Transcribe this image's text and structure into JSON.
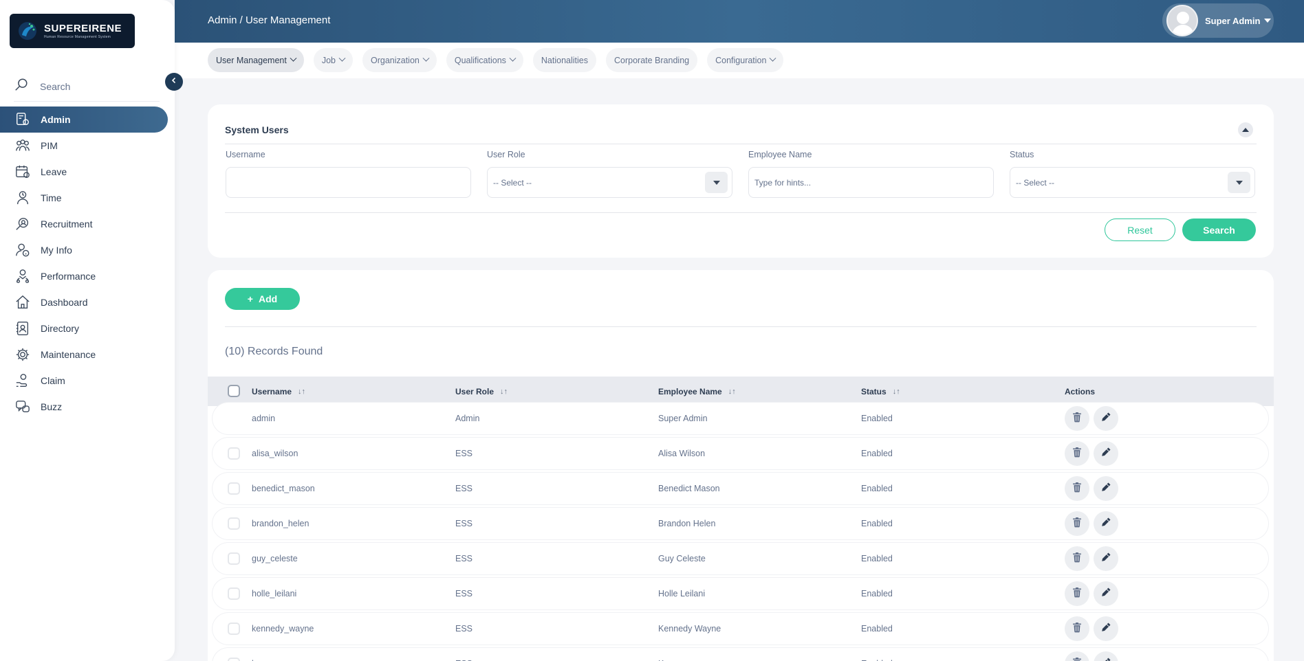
{
  "brand": {
    "name": "SUPEREIRENE",
    "tagline": "Human Resource Management System"
  },
  "sidebar": {
    "search_label": "Search",
    "items": [
      {
        "label": "Admin",
        "icon": "admin-icon",
        "active": true
      },
      {
        "label": "PIM",
        "icon": "pim-icon"
      },
      {
        "label": "Leave",
        "icon": "leave-icon"
      },
      {
        "label": "Time",
        "icon": "time-icon"
      },
      {
        "label": "Recruitment",
        "icon": "recruitment-icon"
      },
      {
        "label": "My Info",
        "icon": "my-info-icon"
      },
      {
        "label": "Performance",
        "icon": "performance-icon"
      },
      {
        "label": "Dashboard",
        "icon": "dashboard-icon"
      },
      {
        "label": "Directory",
        "icon": "directory-icon"
      },
      {
        "label": "Maintenance",
        "icon": "maintenance-icon"
      },
      {
        "label": "Claim",
        "icon": "claim-icon"
      },
      {
        "label": "Buzz",
        "icon": "buzz-icon"
      }
    ]
  },
  "header": {
    "breadcrumb": "Admin / User Management",
    "user_name": "Super Admin"
  },
  "tabs": [
    {
      "label": "User Management",
      "dropdown": true,
      "active": true
    },
    {
      "label": "Job",
      "dropdown": true
    },
    {
      "label": "Organization",
      "dropdown": true
    },
    {
      "label": "Qualifications",
      "dropdown": true
    },
    {
      "label": "Nationalities",
      "dropdown": false
    },
    {
      "label": "Corporate Branding",
      "dropdown": false
    },
    {
      "label": "Configuration",
      "dropdown": true
    }
  ],
  "filter": {
    "title": "System Users",
    "username": {
      "label": "Username",
      "value": ""
    },
    "user_role": {
      "label": "User Role",
      "value": "-- Select --"
    },
    "employee_name": {
      "label": "Employee Name",
      "placeholder": "Type for hints..."
    },
    "status": {
      "label": "Status",
      "value": "-- Select --"
    },
    "reset_label": "Reset",
    "search_label": "Search"
  },
  "table": {
    "add_label": "Add",
    "records_text": "(10) Records Found",
    "columns": [
      "Username",
      "User Role",
      "Employee Name",
      "Status",
      "Actions"
    ],
    "rows": [
      {
        "username": "admin",
        "role": "Admin",
        "employee": "Super Admin",
        "status": "Enabled",
        "checkbox": false
      },
      {
        "username": "alisa_wilson",
        "role": "ESS",
        "employee": "Alisa Wilson",
        "status": "Enabled",
        "checkbox": true
      },
      {
        "username": "benedict_mason",
        "role": "ESS",
        "employee": "Benedict Mason",
        "status": "Enabled",
        "checkbox": true
      },
      {
        "username": "brandon_helen",
        "role": "ESS",
        "employee": "Brandon Helen",
        "status": "Enabled",
        "checkbox": true
      },
      {
        "username": "guy_celeste",
        "role": "ESS",
        "employee": "Guy Celeste",
        "status": "Enabled",
        "checkbox": true
      },
      {
        "username": "holle_leilani",
        "role": "ESS",
        "employee": "Holle Leilani",
        "status": "Enabled",
        "checkbox": true
      },
      {
        "username": "kennedy_wayne",
        "role": "ESS",
        "employee": "Kennedy Wayne",
        "status": "Enabled",
        "checkbox": true
      },
      {
        "username": "k...",
        "role": "ESS",
        "employee": "K...",
        "status": "Enabled",
        "checkbox": true
      }
    ]
  },
  "colors": {
    "accent": "#35c99b",
    "header": "#2b5277",
    "active_nav": "#2c5179"
  }
}
